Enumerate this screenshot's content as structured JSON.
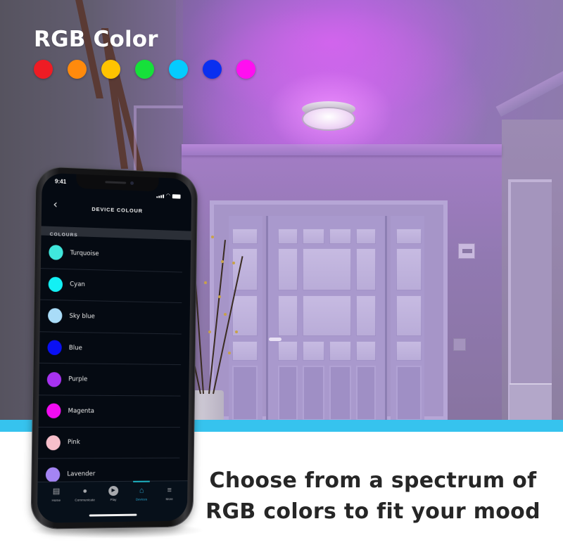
{
  "hero": {
    "title": "RGB Color",
    "swatches": [
      {
        "name": "red",
        "color": "#ee1c24"
      },
      {
        "name": "orange",
        "color": "#ff8a0c"
      },
      {
        "name": "yellow",
        "color": "#ffc300"
      },
      {
        "name": "green",
        "color": "#16e03a"
      },
      {
        "name": "sky-blue",
        "color": "#05cbff"
      },
      {
        "name": "blue",
        "color": "#0a2ff0"
      },
      {
        "name": "magenta",
        "color": "#ff0ff0"
      }
    ]
  },
  "phone": {
    "status_bar": {
      "time": "9:41"
    },
    "header": {
      "back_icon": "chevron-left-icon",
      "title": "DEVICE COLOUR"
    },
    "section_label": "COLOURS",
    "colors": [
      {
        "label": "Turquoise",
        "color": "#40e7dc"
      },
      {
        "label": "Cyan",
        "color": "#13f0f4"
      },
      {
        "label": "Sky blue",
        "color": "#a9dcf8"
      },
      {
        "label": "Blue",
        "color": "#0a10f4"
      },
      {
        "label": "Purple",
        "color": "#a732f0"
      },
      {
        "label": "Magenta",
        "color": "#f20cf2"
      },
      {
        "label": "Pink",
        "color": "#f7bfcb"
      },
      {
        "label": "Lavender",
        "color": "#a484f4"
      }
    ],
    "nav": [
      {
        "label": "Home",
        "icon": "home-icon",
        "active": false
      },
      {
        "label": "Communicate",
        "icon": "chat-bubble-icon",
        "active": false
      },
      {
        "label": "Play",
        "icon": "play-icon",
        "active": false
      },
      {
        "label": "Devices",
        "icon": "devices-house-icon",
        "active": true
      },
      {
        "label": "More",
        "icon": "menu-icon",
        "active": false
      }
    ],
    "accent_color": "#2aa9d3"
  },
  "tagline": {
    "line1": "Choose from a spectrum of",
    "line2": "RGB colors to fit your mood"
  },
  "band_color": "#36c3ee"
}
